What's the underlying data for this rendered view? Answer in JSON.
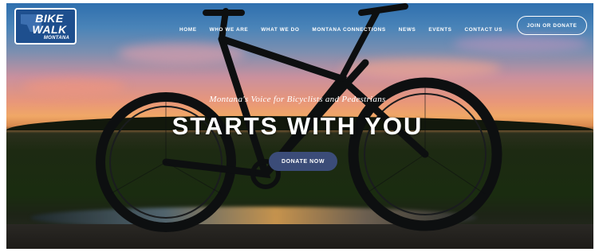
{
  "brand": {
    "logo_line1": "BIKE",
    "logo_line2": "WALK",
    "logo_line3": "MONTANA"
  },
  "nav": {
    "items": [
      {
        "label": "HOME"
      },
      {
        "label": "WHO WE ARE"
      },
      {
        "label": "WHAT WE DO"
      },
      {
        "label": "MONTANA CONNECTIONS"
      },
      {
        "label": "NEWS"
      },
      {
        "label": "EVENTS"
      },
      {
        "label": "CONTACT US"
      }
    ],
    "cta_label": "JOIN OR DONATE"
  },
  "hero": {
    "tagline": "Montana's Voice for Bicyclists and Pedestrians",
    "headline": "STARTS WITH YOU",
    "button_label": "DONATE NOW"
  },
  "icons": {
    "logo_state_shape": "montana-state-icon"
  },
  "colors": {
    "logo_bg": "#1e4f8e",
    "donate_button": "#3b4c78",
    "text": "#ffffff"
  }
}
